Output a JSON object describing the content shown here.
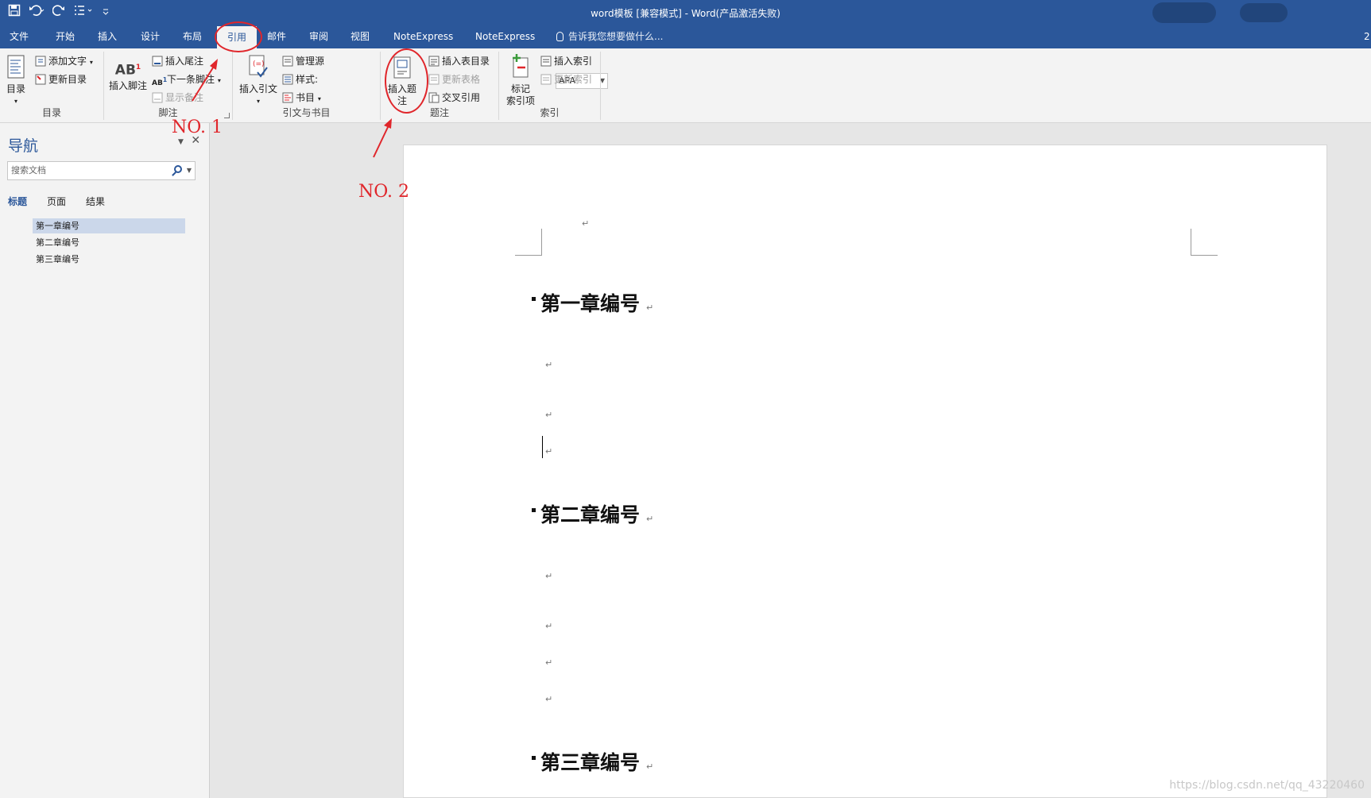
{
  "window": {
    "title": "word模板 [兼容模式] - Word(产品激活失败)"
  },
  "qat": {
    "save_icon": "save-icon",
    "undo_icon": "undo-icon",
    "redo_icon": "redo-icon",
    "format_icon": "list-format-icon",
    "more_icon": "customize-icon"
  },
  "tabs": [
    "文件",
    "开始",
    "插入",
    "设计",
    "布局",
    "引用",
    "邮件",
    "审阅",
    "视图",
    "NoteExpress",
    "NoteExpress"
  ],
  "active_tab": "引用",
  "tell_me": "告诉我您想要做什么...",
  "edge_char": "2",
  "ribbon": {
    "toc": {
      "big": "目录",
      "add_text": "添加文字",
      "update_toc": "更新目录",
      "label": "目录"
    },
    "footnote": {
      "big": "插入脚注",
      "insert_endnote": "插入尾注",
      "next_footnote": "下一条脚注",
      "show_notes": "显示备注",
      "label": "脚注"
    },
    "citation": {
      "big": "插入引文",
      "manage_sources": "管理源",
      "style_label": "样式:",
      "style_value": "APA",
      "bibliography": "书目",
      "label": "引文与书目"
    },
    "caption": {
      "big": "插入题注",
      "insert_tof": "插入表目录",
      "update_table": "更新表格",
      "cross_ref": "交叉引用",
      "label": "题注"
    },
    "index": {
      "big_line1": "标记",
      "big_line2": "索引项",
      "insert_index": "插入索引",
      "update_index": "更新索引",
      "label": "索引"
    }
  },
  "nav": {
    "title": "导航",
    "search_placeholder": "搜索文档",
    "tabs": [
      "标题",
      "页面",
      "结果"
    ],
    "headings": [
      "第一章编号",
      "第二章编号",
      "第三章编号"
    ]
  },
  "doc": {
    "headings": [
      "第一章编号",
      "第二章编号",
      "第三章编号"
    ],
    "para_mark": "↵"
  },
  "annotations": {
    "no1": "NO. 1",
    "no2": "NO. 2",
    "color": "#e0262b"
  },
  "watermark": "https://blog.csdn.net/qq_43220460"
}
